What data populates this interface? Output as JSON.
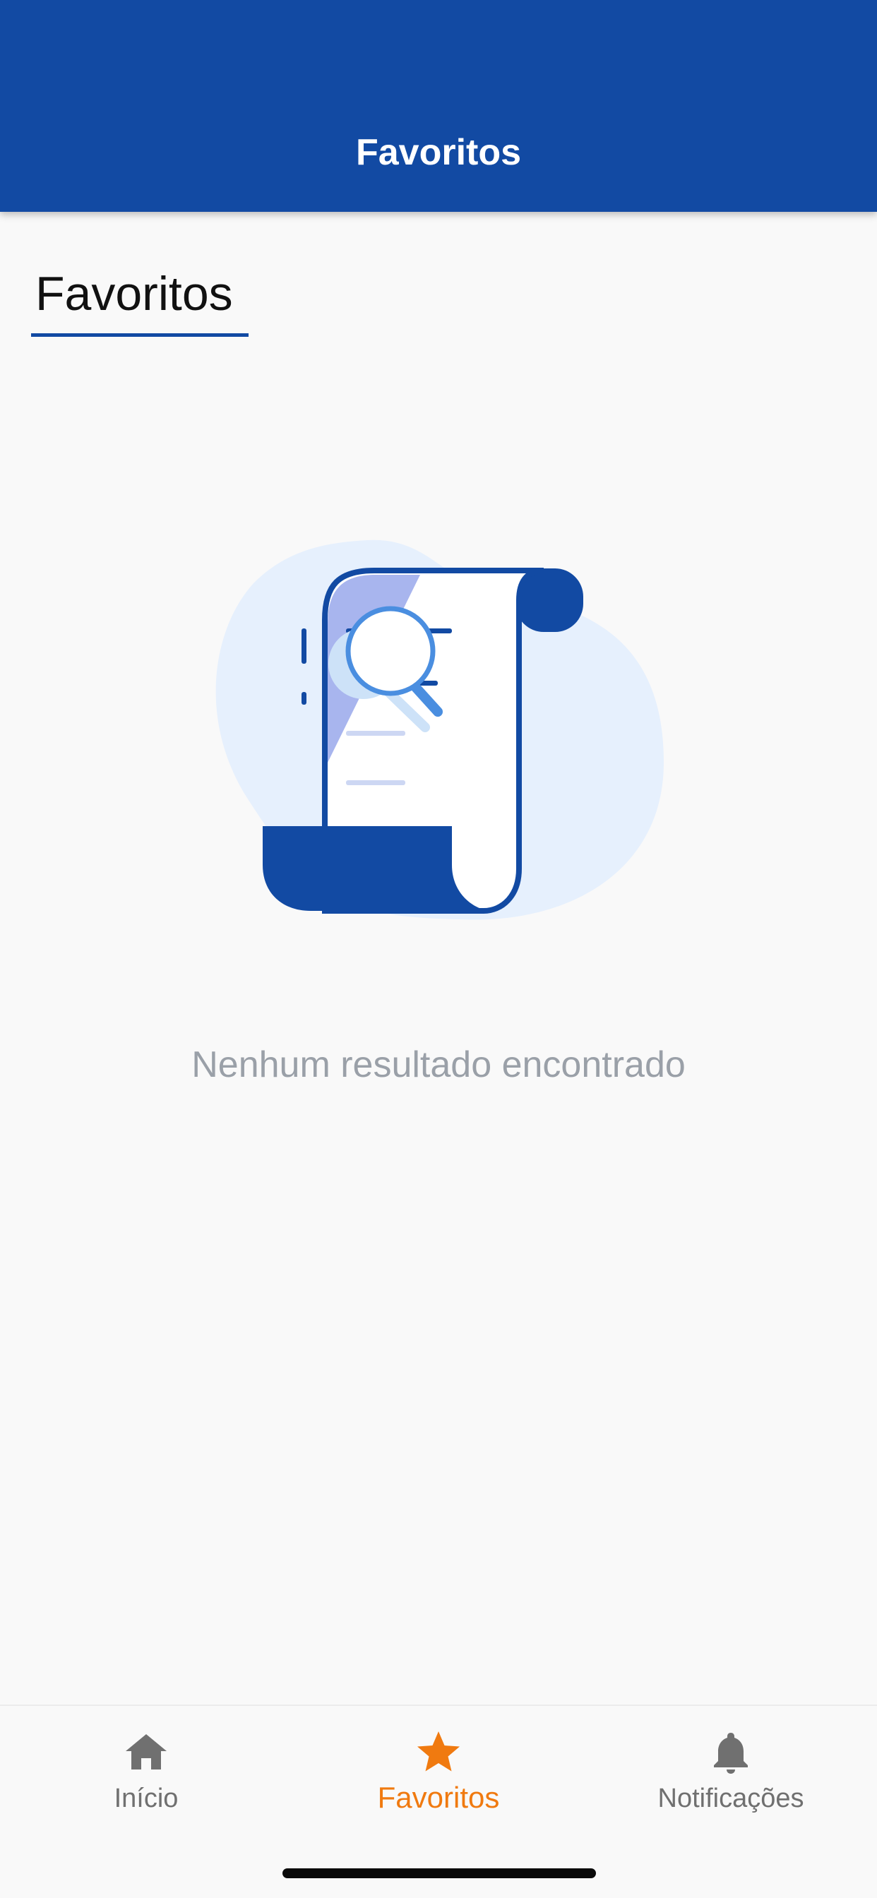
{
  "app_bar": {
    "title": "Favoritos"
  },
  "section": {
    "title": "Favoritos"
  },
  "empty_state": {
    "illustration": "document-search-illustration",
    "message": "Nenhum resultado encontrado"
  },
  "bottom_nav": {
    "items": [
      {
        "label": "Início",
        "icon": "home-icon",
        "active": false
      },
      {
        "label": "Favoritos",
        "icon": "star-icon",
        "active": true
      },
      {
        "label": "Notificações",
        "icon": "bell-icon",
        "active": false
      }
    ]
  },
  "colors": {
    "primary": "#124aa3",
    "accent": "#f07a10",
    "inactive": "#707070",
    "muted_text": "#9aa0a8",
    "background": "#f9f9f9"
  }
}
